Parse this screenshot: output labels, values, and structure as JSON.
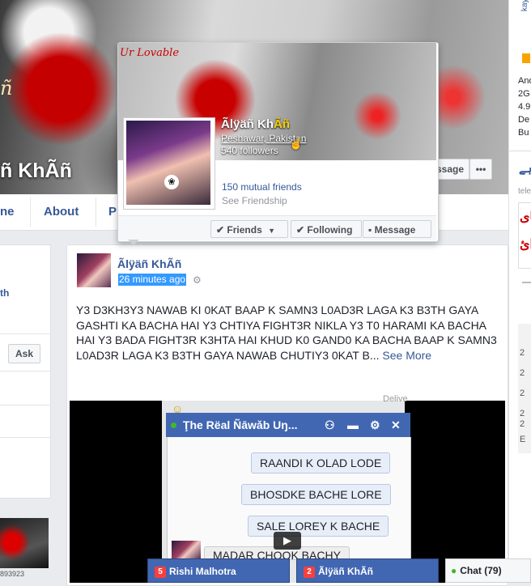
{
  "profile": {
    "cover_name": "ñ KhÃñ",
    "message_button": "ssage",
    "more_button": "•••"
  },
  "tabs": [
    "ne",
    "About",
    "P"
  ],
  "left": {
    "ask_button": "Ask",
    "side_letters": "th",
    "footer_code": "893923"
  },
  "post": {
    "author": "Ãlÿäñ KhÃñ",
    "time": "26 minutes ago",
    "text": "Y3 D3KH3Y3 NAWAB KI 0KAT BAAP K SAMN3 L0AD3R LAGA K3 B3TH GAYA GASHTI KA BACHA HAI Y3 CHTIYA FIGHT3R NIKLA Y3 T0 HARAMI KA BACHA HAI Y3 BADA FIGHT3R K3HTA HAI KHUD K0 GAND0 KA BACHA BAAP K SAMN3 L0AD3R LAGA K3 B3TH GAYA NAWAB CHUTIY3 0KAT B...",
    "see_more": "See More"
  },
  "video_chat": {
    "title": "Ţhe Rëal Ñāwǎb Uŋ...",
    "messages": [
      "RAANDI K OLAD LODE",
      "BHOSDKE BACHE LORE",
      "SALE LOREY K BACHE",
      "MADAR CHOOK BACHY"
    ],
    "corner_text": "Delive",
    "play_icon": "▶"
  },
  "hovercard": {
    "name_main": "Ãlÿäñ Kh",
    "name_accent": "Ãñ",
    "location": "Peshawar, Pakistan",
    "followers": "540 followers",
    "mutual": "150 mutual friends",
    "see_friendship": "See Friendship",
    "buttons": {
      "friends": "Friends",
      "following": "Following",
      "message": "Message"
    },
    "accent_color": "#f5d000"
  },
  "right_strip": {
    "url": "kaymu.pk",
    "lines": [
      "And",
      "2G",
      "4.9",
      "De",
      "Bu",
      "tele"
    ],
    "numbers": [
      "2",
      "2",
      "2",
      "2",
      "2",
      "E"
    ]
  },
  "dock": {
    "chats": [
      {
        "badge": "5",
        "name": "Rishi Malhotra"
      },
      {
        "badge": "2",
        "name": "Ãlÿäñ KhÃñ"
      }
    ],
    "chat_label": "Chat (79)"
  }
}
